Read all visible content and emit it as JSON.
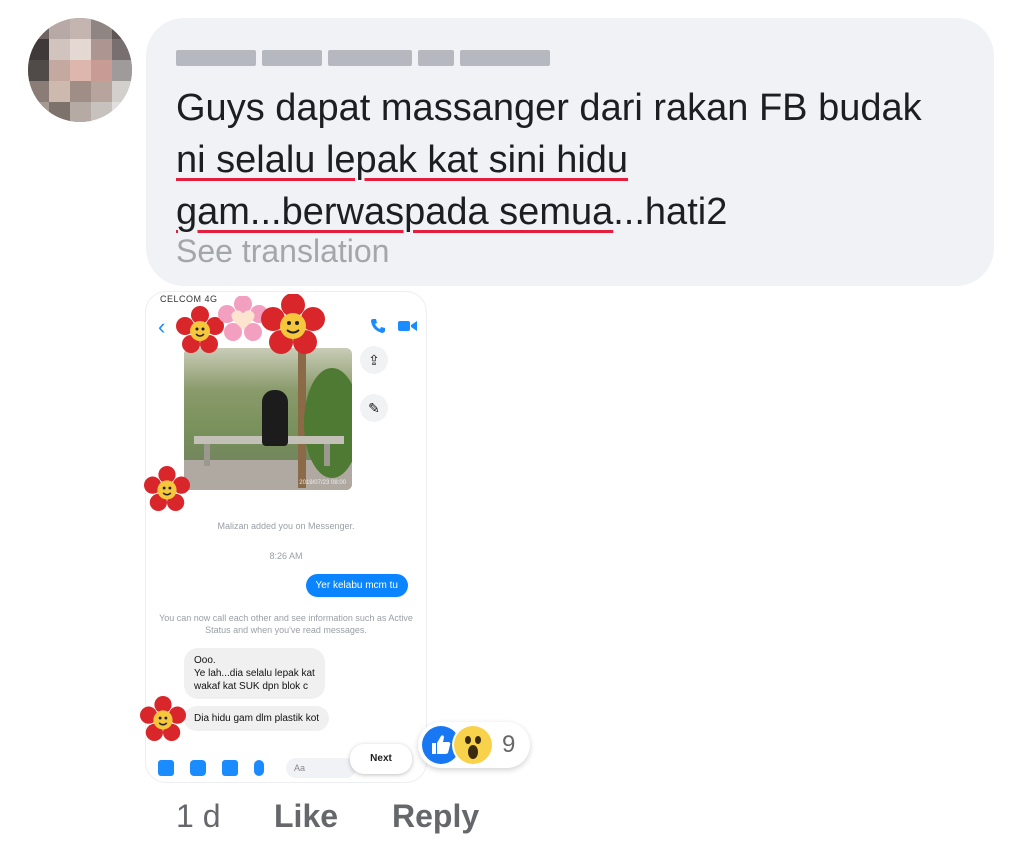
{
  "comment": {
    "author_name_obscured": "",
    "lines": [
      "Guys dapat massanger dari rakan FB budak",
      "ni selalu lepak kat sini hidu",
      "gam...berwaspada semua...hati2"
    ],
    "line3_rest": "...hati2",
    "see_translation": "See translation"
  },
  "screenshot": {
    "carrier": "CELCOM 4G",
    "photo_timestamp": "2019/07/23 08:00",
    "system_added": "Malizan added you on Messenger.",
    "time": "8:26 AM",
    "my_message": "Yer kelabu mcm tu",
    "system_call": "You can now call each other and see information such as Active Status and when you've read messages.",
    "their_message_1_line1": "Ooo.",
    "their_message_1_line2": "Ye lah...dia selalu lepak kat",
    "their_message_1_line3": "wakaf kat SUK dpn blok c",
    "their_message_2": "Dia hidu gam dlm plastik kot",
    "composer_placeholder": "Aa",
    "next_label": "Next"
  },
  "reactions": {
    "count": "9",
    "types": [
      "like",
      "wow"
    ]
  },
  "footer": {
    "time": "1 d",
    "like": "Like",
    "reply": "Reply"
  },
  "colors": {
    "bubble_bg": "#f0f2f5",
    "spell_underline": "#e41e3f",
    "messenger_blue": "#0a84ff",
    "like_blue": "#1877f2"
  }
}
